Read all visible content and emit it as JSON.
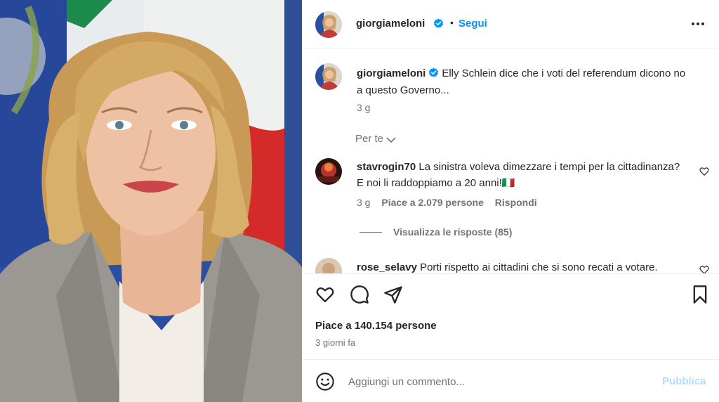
{
  "post": {
    "username": "giorgiameloni",
    "follow_label": "Segui",
    "separator": "•",
    "more_icon": "more-horizontal-icon",
    "verified_icon": "verified-badge-icon"
  },
  "caption": {
    "username": "giorgiameloni",
    "text": "Elly Schlein dice che i voti del referendum dicono no a questo Governo...",
    "time": "3 g"
  },
  "filter": {
    "label": "Per te",
    "icon": "chevron-down-icon"
  },
  "comments": [
    {
      "username": "stavrogin70",
      "text": "La sinistra voleva dimezzare i tempi per la cittadinanza? E noi li raddoppiamo a 20 anni!🇮🇹",
      "time": "3 g",
      "likes": "Piace a 2.079 persone",
      "reply_label": "Rispondi",
      "view_replies": "Visualizza le risposte (85)"
    },
    {
      "username": "rose_selavy",
      "text": "Porti rispetto ai cittadini che si sono recati a votare."
    }
  ],
  "actions": {
    "like_icon": "heart-icon",
    "comment_icon": "comment-icon",
    "share_icon": "send-icon",
    "save_icon": "bookmark-icon"
  },
  "likes": "Piace a 140.154 persone",
  "date": "3 giorni fa",
  "add_comment": {
    "placeholder": "Aggiungi un commento...",
    "publish_label": "Pubblica",
    "emoji_icon": "emoji-icon"
  },
  "colors": {
    "accent": "#0095f6",
    "publish_disabled": "#b2dffc",
    "secondary_text": "#737373",
    "primary_text": "#262626"
  }
}
